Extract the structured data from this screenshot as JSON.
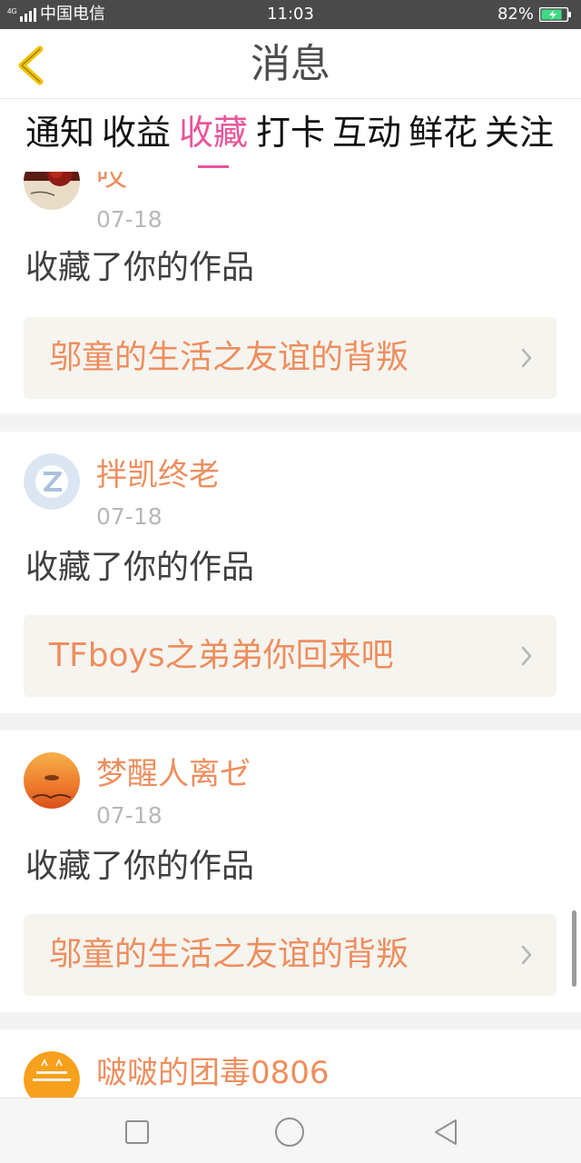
{
  "status_bar": {
    "network": "4G",
    "carrier": "中国电信",
    "time": "11:03",
    "battery": "82%",
    "battery_level": 0.82,
    "battery_color": "#3ddc84"
  },
  "header": {
    "back_icon": "chevron-left-icon",
    "title": "消息",
    "accent_color": "#f2c200"
  },
  "tabs": {
    "items": [
      "通知",
      "收益",
      "收藏",
      "打卡",
      "互动",
      "鲜花",
      "关注"
    ],
    "active_index": 2,
    "active_color": "#e8559a"
  },
  "feed": {
    "items": [
      {
        "username": "哎",
        "date": "07-18",
        "action": "收藏了你的作品",
        "work_title": "邬童的生活之友谊的背叛",
        "avatar": "rose-photo-avatar"
      },
      {
        "username": "拌凯终老",
        "date": "07-18",
        "action": "收藏了你的作品",
        "work_title": "TFboys之弟弟你回来吧",
        "avatar": "qq-default-avatar"
      },
      {
        "username": "梦醒人离ゼ",
        "date": "07-18",
        "action": "收藏了你的作品",
        "work_title": "邬童的生活之友谊的背叛",
        "avatar": "sunset-avatar"
      },
      {
        "username": "啵啵的团毒0806",
        "avatar": "orange-cartoon-avatar"
      }
    ],
    "username_color": "#ee8e5e",
    "work_bg_color": "#f5f4ef"
  },
  "nav_bar": {
    "buttons": [
      "square-recents-icon",
      "circle-home-icon",
      "triangle-back-icon"
    ]
  }
}
